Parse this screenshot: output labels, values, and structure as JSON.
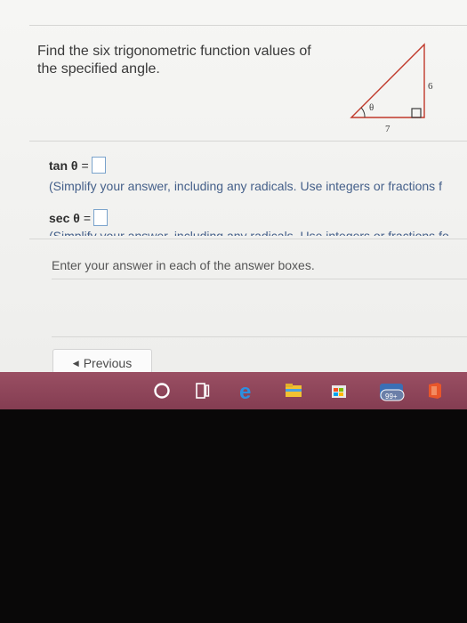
{
  "question": {
    "text": "Find the six trigonometric function values of the specified angle."
  },
  "triangle": {
    "angle_label": "θ",
    "opposite_label": "6",
    "adjacent_label": "7"
  },
  "answers": [
    {
      "func": "tan θ",
      "eq": "=",
      "hint": "(Simplify your answer, including any radicals. Use integers or fractions f"
    },
    {
      "func": "sec θ",
      "eq": "=",
      "hint": "(Simplify your answer, including any radicals. Use integers or fractions fo"
    }
  ],
  "footer": {
    "message": "Enter your answer in each of the answer boxes.",
    "previous_label": "Previous"
  },
  "taskbar": {
    "mail_badge": "99+",
    "colors": {
      "taskbar": "#8a4257",
      "edge": "#2d8fe0",
      "office": "#e8562a"
    },
    "icons": [
      "cortana-icon",
      "task-view-icon",
      "edge-icon",
      "file-explorer-icon",
      "store-icon",
      "mail-icon",
      "office-icon"
    ]
  }
}
